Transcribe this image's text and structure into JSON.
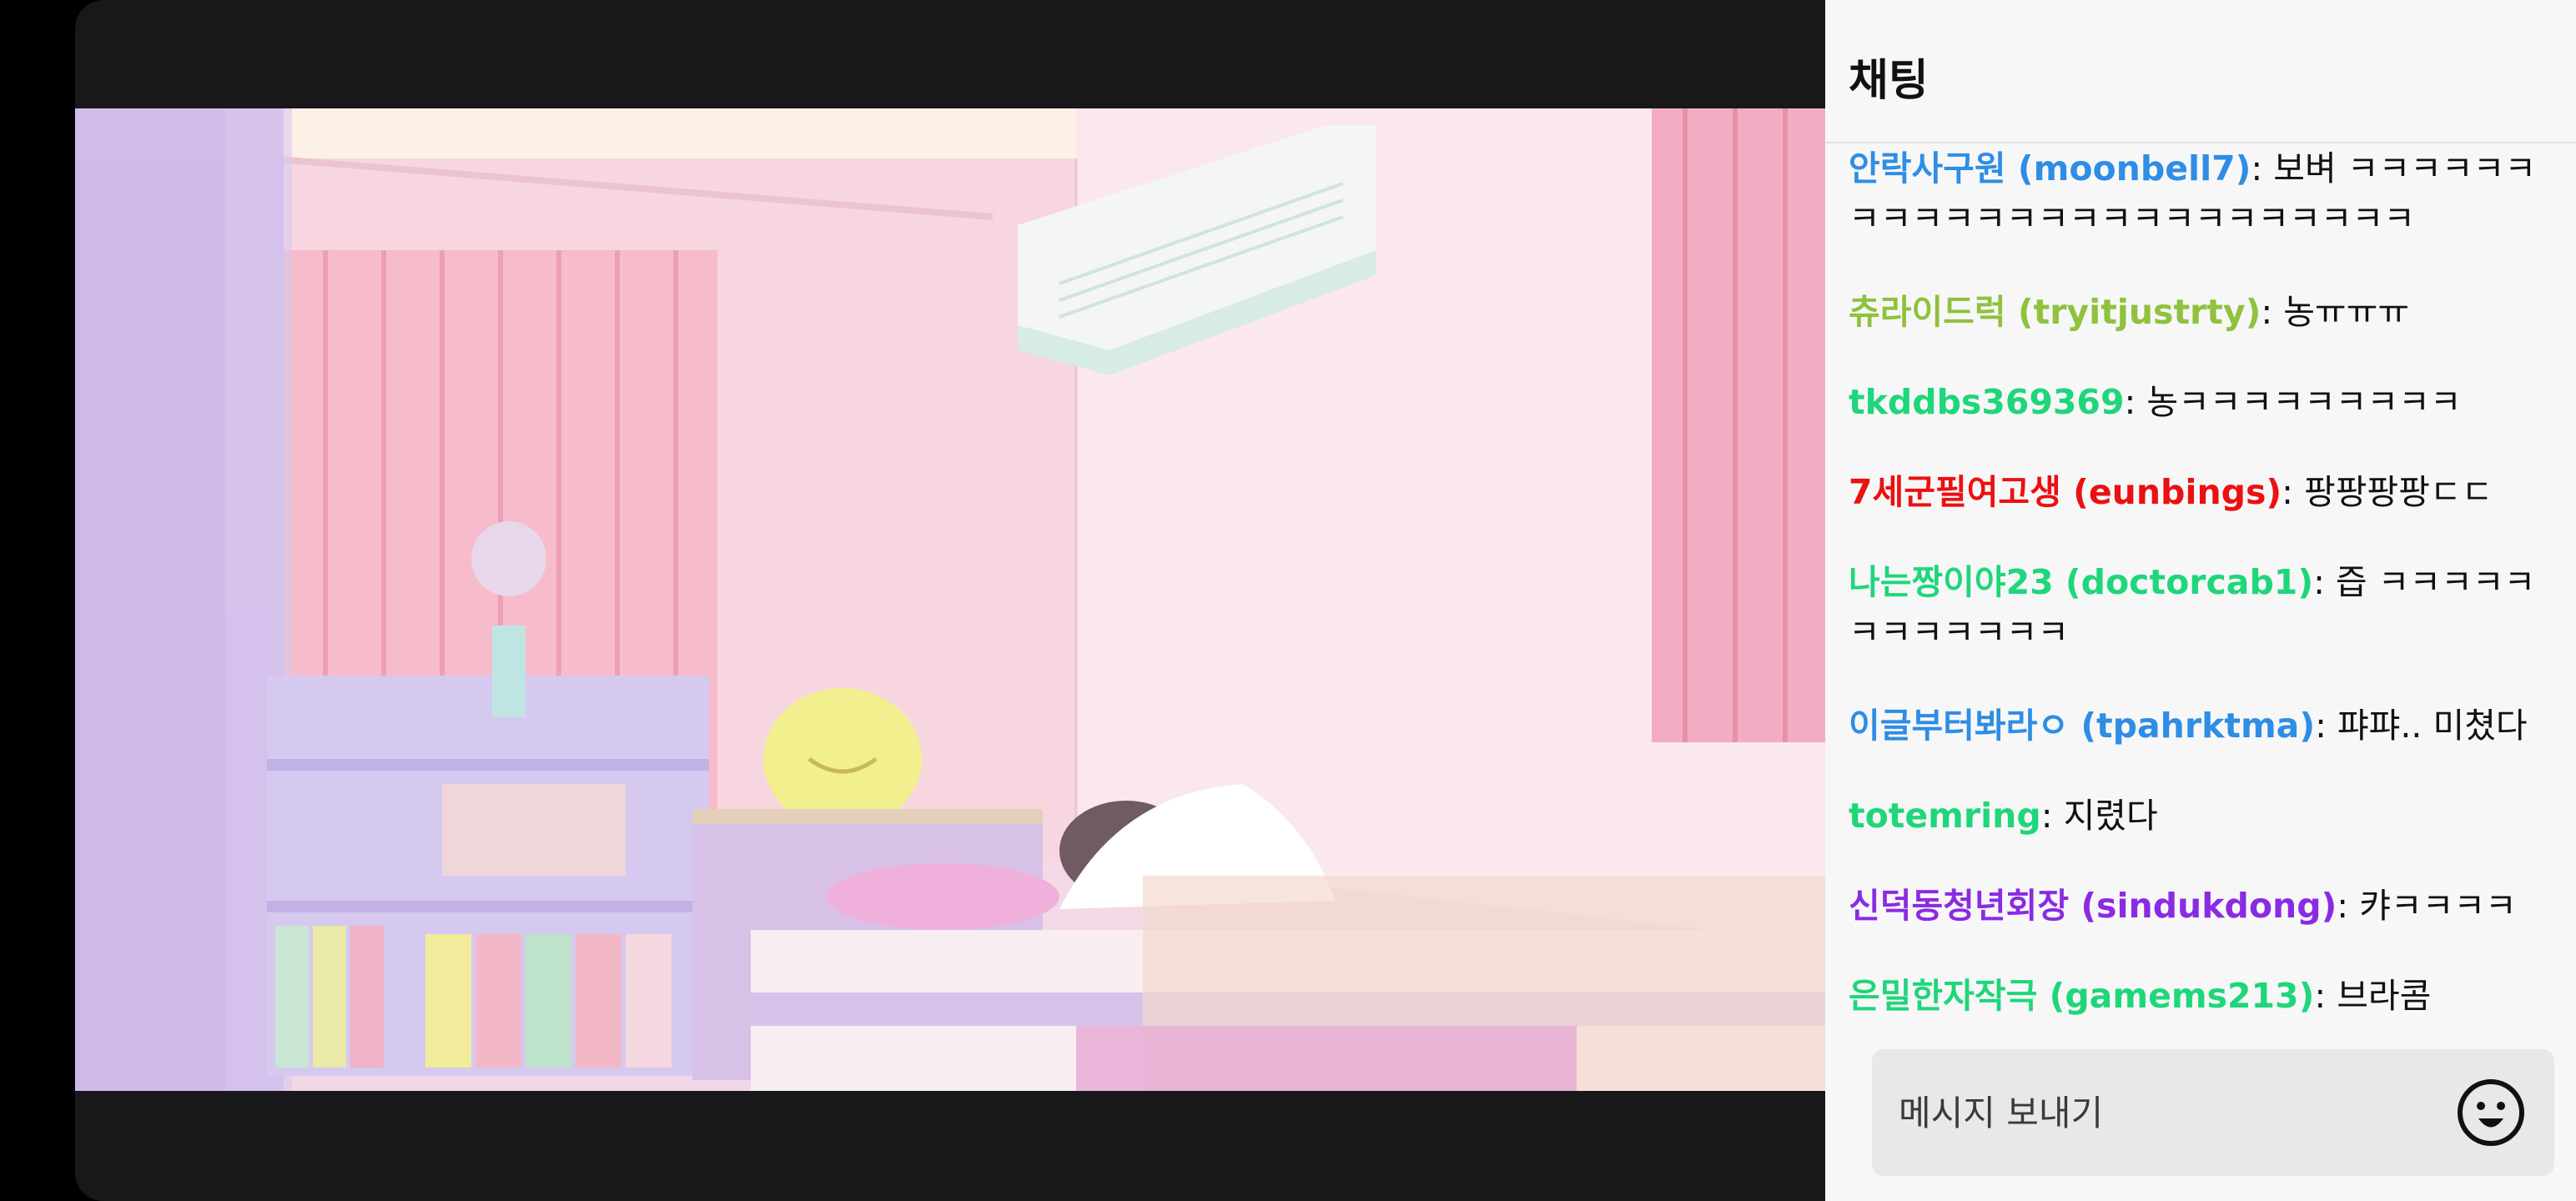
{
  "chat": {
    "title": "채팅",
    "messages": [
      {
        "user": "안락사구원 (moonbell7)",
        "color": "#2f8de4",
        "sep": ": ",
        "text": "보벼 ㅋㅋㅋㅋㅋㅋㅋㅋㅋㅋㅋㅋㅋㅋㅋㅋㅋㅋㅋㅋㅋㅋㅋㅋ"
      },
      {
        "user": "츄라이드럭 (tryitjustrty)",
        "color": "#8fc23d",
        "sep": ": ",
        "text": "농ㅠㅠㅠ"
      },
      {
        "user": "tkddbs369369",
        "color": "#1fd67a",
        "sep": ": ",
        "text": "농ㅋㅋㅋㅋㅋㅋㅋㅋㅋ"
      },
      {
        "user": "7세군필여고생 (eunbings)",
        "color": "#ec1010",
        "sep": ": ",
        "text": "팡팡팡팡ㄷㄷ"
      },
      {
        "user": "나는짱이야23 (doctorcab1)",
        "color": "#1fd67a",
        "sep": ": ",
        "text": "즙 ㅋㅋㅋㅋㅋㅋㅋㅋㅋㅋㅋㅋ"
      },
      {
        "user": "이글부터봐라ㅇ (tpahrktma)",
        "color": "#2f8de4",
        "sep": ": ",
        "text": "퍄퍄.. 미쳤다"
      },
      {
        "user": "totemring",
        "color": "#1fd67a",
        "sep": ": ",
        "text": "지렸다"
      },
      {
        "user": "신덕동청년회장 (sindukdong)",
        "color": "#8a2be2",
        "sep": ": ",
        "text": "캬ㅋㅋㅋㅋ"
      },
      {
        "user": "은밀한자작극 (gamems213)",
        "color": "#1fd67a",
        "sep": ": ",
        "text": "브라콤"
      }
    ],
    "composer": {
      "placeholder": "메시지 보내기",
      "emoji_icon": "smiley-face-icon"
    }
  },
  "player": {
    "frame_icon": "anime-room-scene"
  },
  "colors": {
    "chat_bg": "#f7f7f8",
    "player_bg": "#18181b",
    "input_bg": "#e8e8ea"
  }
}
